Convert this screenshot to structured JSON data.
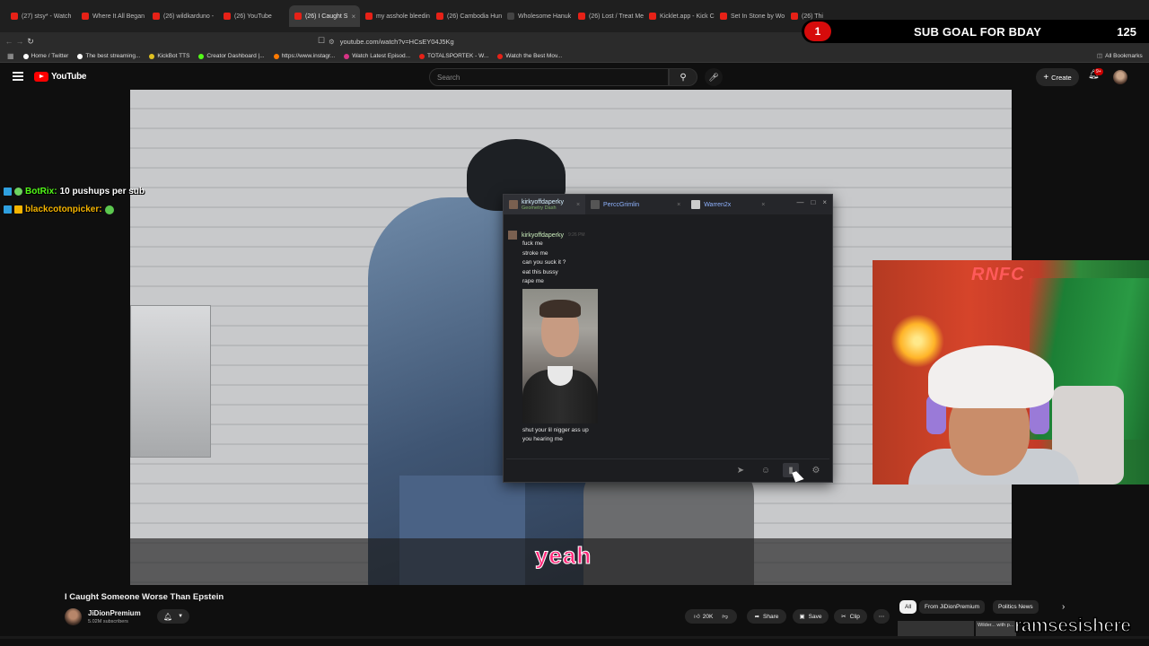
{
  "browser": {
    "tabs": [
      {
        "label": "(27) stsy* - Watch",
        "fav": "red"
      },
      {
        "label": "Where It All Began",
        "fav": "red"
      },
      {
        "label": "(26) wildkarduno -",
        "fav": "red"
      },
      {
        "label": "(26) YouTube",
        "fav": "red"
      },
      {
        "label": "(26) I Caught S",
        "fav": "red",
        "active": true
      },
      {
        "label": "my asshole bleedin",
        "fav": "red"
      },
      {
        "label": "(26) Cambodia Hun",
        "fav": "red"
      },
      {
        "label": "Wholesome Hanuk",
        "fav": "dark"
      },
      {
        "label": "(26) Lost / Treat Me",
        "fav": "red"
      },
      {
        "label": "Kicklet.app - Kick C",
        "fav": "red"
      },
      {
        "label": "Set In Stone by Wo",
        "fav": "red"
      },
      {
        "label": "(26) Thi",
        "fav": "red"
      }
    ],
    "url": "youtube.com/watch?v=HCsEY04J5Kg",
    "bookmarks": [
      "Home / Twitter",
      "The best streaming...",
      "KickBot TTS",
      "Creator Dashboard |...",
      "https://www.instagr...",
      "Watch Latest Episod...",
      "TOTALSPORTEK - W...",
      "Watch the Best Mov..."
    ],
    "all_bookmarks": "All Bookmarks"
  },
  "overlay": {
    "badge": "1",
    "sub_goal_label": "SUB GOAL FOR BDAY",
    "sub_goal_count": "125",
    "caption": "yeah",
    "username": "ramsesishere",
    "stream_chat": [
      {
        "user": "BotRix:",
        "text": "10 pushups per sub",
        "color": "#53fc18"
      },
      {
        "user": "blackcotonpicker:",
        "text": "",
        "color": "#f5b400"
      }
    ]
  },
  "youtube": {
    "logo": "YouTube",
    "search_placeholder": "Search",
    "create_label": "Create",
    "notif_count": "9+",
    "video_title": "I Caught Someone Worse Than Epstein",
    "channel": "JiDionPremium",
    "subscribers": "5.02M subscribers",
    "likes": "20K",
    "share": "Share",
    "save": "Save",
    "clip": "Clip",
    "chips": [
      "All",
      "From JiDionPremium",
      "Politics News"
    ],
    "mini_thumb_text": "Wilder... with p..."
  },
  "dm_window": {
    "tabs": [
      {
        "name": "kirkyoffdaperky",
        "sub": "Geometry Dash",
        "active": true
      },
      {
        "name": "PerccGrimlin",
        "sub": ""
      },
      {
        "name": "Warren2x",
        "sub": ""
      }
    ],
    "sender": "kirkyoffdaperky",
    "time": "9:26 PM",
    "messages_before": [
      "fuck me",
      "stroke me",
      "can you suck it ?",
      "eat this bussy",
      "rape me"
    ],
    "messages_after": [
      "shut your lil nigger ass up",
      "you hearing me"
    ]
  },
  "colors": {
    "accent_red": "#ff0000",
    "caption_pink": "#ff2a7a",
    "dm_name_green": "#ccefbd",
    "dm_tab_blue": "#8fb3ff"
  }
}
